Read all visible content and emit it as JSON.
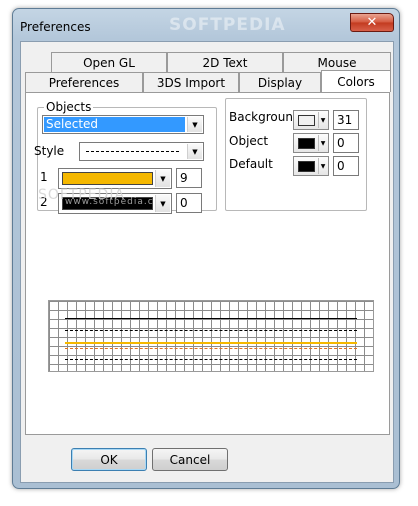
{
  "window": {
    "title": "Preferences",
    "watermark_title": "SOFTPEDIA",
    "close_glyph": "✕"
  },
  "tabs": {
    "row_back": [
      {
        "label": "Open GL"
      },
      {
        "label": "2D Text"
      },
      {
        "label": "Mouse"
      }
    ],
    "row_front": [
      {
        "label": "Preferences"
      },
      {
        "label": "3DS Import"
      },
      {
        "label": "Display"
      },
      {
        "label": "Colors",
        "active": true
      }
    ]
  },
  "objects": {
    "legend": "Objects",
    "selector_value": "Selected",
    "style_label": "Style",
    "style_value": "dashed",
    "row1": {
      "index": "1",
      "color": "#f5b800",
      "width": "9"
    },
    "row2": {
      "index": "2",
      "color": "#000000",
      "width": "0",
      "watermark": "www.softpedia.com"
    }
  },
  "colors": {
    "background": {
      "label": "Background",
      "color": "#f0f0f0",
      "value": "31"
    },
    "object": {
      "label": "Object",
      "color": "#000000",
      "value": "0"
    },
    "default": {
      "label": "Default",
      "color": "#000000",
      "value": "0"
    }
  },
  "watermark_overlay": "SOFTPEDIA",
  "buttons": {
    "ok": "OK",
    "cancel": "Cancel"
  },
  "icons": {
    "dropdown": "▼",
    "close": "close-icon"
  }
}
